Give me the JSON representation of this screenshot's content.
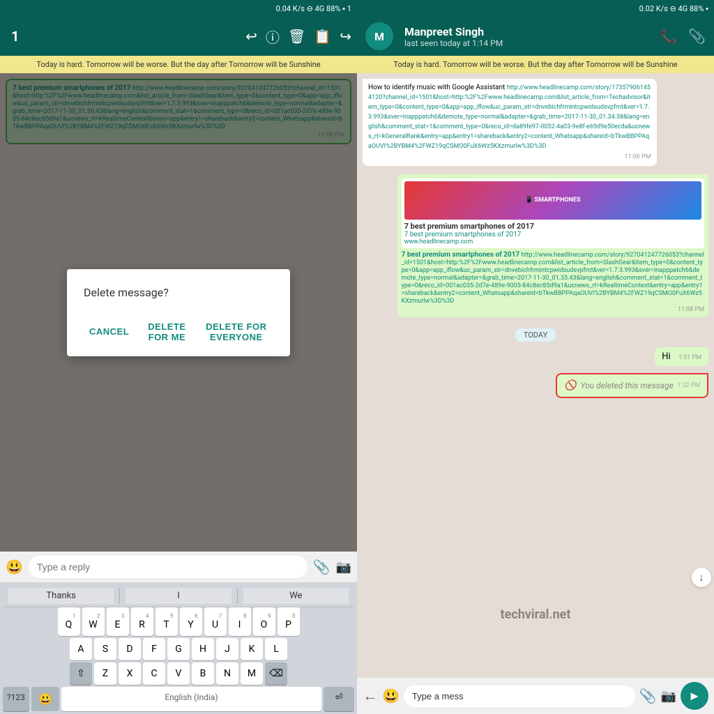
{
  "left": {
    "status_bar": "0.04 K/s ⊖ 4G 88% ▪ 1",
    "toolbar": {
      "count": "1",
      "icons": [
        "reply-icon",
        "info-icon",
        "delete-icon",
        "copy-icon",
        "forward-icon"
      ]
    },
    "notification": "Today is hard. Tomorrow will be worse. But the day after Tomorrow will be Sunshine",
    "message_title": "7 best premium smartphones of 2017",
    "message_url": "http://www.headlinecamp.com/story/927041247726053?channel_id=1501&host=http:%2F%2Fwww.headlinecamp.com&list_article_from=SlashGear&item_type=0&content_type=0&app=app_iflow&uc_param_str=dnvebichfrmintcpwidsudsvpfmt&ver=1.7.3.993&sver=inapppatch6&demote_type=normal&adapter=&grab_time=2017-11-30_01.35.43&lang=english&comment_stat=1&comment_type=0&reco_id=001ac035-2d7e-489e-9005-84c8ec85d9a1&ucnews_rt=kRealtimeContext&entry=app&entry1=shareback&entry2=content_Whatsapp&shareid=bTkwBBPPAqaOUVI%2BYBM4%2FWZ19qCSMO0FuX6Wz5KXzmurlw%3D%3D",
    "message_time": "11:08 PM",
    "dialog": {
      "title": "Delete message?",
      "cancel": "CANCEL",
      "delete_for_me": "DELETE FOR ME",
      "delete_for_everyone": "DELETE FOR EVERYONE"
    },
    "input_placeholder": "Type a reply",
    "keyboard": {
      "row1": [
        "Q",
        "W",
        "E",
        "R",
        "T",
        "Y",
        "U",
        "I",
        "O",
        "P"
      ],
      "row2": [
        "A",
        "S",
        "D",
        "F",
        "G",
        "H",
        "J",
        "K",
        "L"
      ],
      "row3": [
        "Z",
        "X",
        "C",
        "V",
        "B",
        "N",
        "M"
      ],
      "thanks_suggestion": "Thanks",
      "i_suggestion": "I",
      "we_suggestion": "We"
    }
  },
  "right": {
    "status_bar": "0.02 K/s ⊖ 4G 88% ▪",
    "contact": {
      "name": "Manpreet Singh",
      "status": "last seen today at 1:14 PM"
    },
    "notification": "Today is hard. Tomorrow will be worse. But the day after Tomorrow will be Sunshine",
    "messages": [
      {
        "type": "received",
        "text": "How to identify music with Google Assistant",
        "link": "http://www.headlinecamp.com/story/173579061454120?channel_id=1501&host=http:%2F%2Fwww.headlinecamp.com&list_article_from=Techadvisor&item_type=0&content_type=0&app=app_iflow&uc_param_str=dnvebichfrmintcpwidsudsvpfmt&ver=1.7.3.993&sver=inapppatch6&demote_type=normal&adapter=&grab_time=2017-11-30_01.34.38&lang=english&comment_stat=1&comment_type=0&reco_id=da89fe97-0052-4a03-9e8f-e69d9e50ecda&ucnews_rt=kGeneralRank&entry=app&entry1=shareback&entry2=content_Whatsapp&shareid=bTkwBBPPAqaOUVI%2BYBM4%2FWZ19qCSMO0FuX6Wz5KXzmurlw%3D%3D",
        "time": "11:06 PM"
      },
      {
        "type": "sent_preview",
        "preview_title": "7 best premium smartphones of 2017",
        "preview_url": "www.headlinecamp.com",
        "text": "7 best premium smartphones of 2017",
        "link": "http://www.headlinecamp.com/story/927041247726053?channel_id=1501&host=http:%2F%2Fwww.headlinecamp.com&list_article_from=SlashGear&item_type=0&content_type=0&app=app_iflow&uc_param_str=dnvebichfrmintcpwidsudsvpfmt&ver=1.7.3.993&sver=inapppatch6&demote_type=normal&adapter=&grab_time=2017-11-30_01.35.43&lang=english&comment_stat=1&comment_type=0&reco_id=001ac035-2d7e-489e-9005-84c8ec85d9a1&ucnews_rt=kRealtimeContext&entry=app&entry1=shareback&entry2=content_Whatsapp&shareid=bTkwBBPPAqaOUVI%2BYBM4%2FWZ19qCSMO0FuX6Wz5KXzmurlw%3D%3D",
        "time": "11:08 PM"
      }
    ],
    "today_label": "TODAY",
    "hi_message": {
      "text": "Hi",
      "time": "1:31 PM"
    },
    "deleted_message": {
      "text": "You deleted this message",
      "time": "1:32 PM",
      "icon": "🚫"
    },
    "input_placeholder": "Type a mess",
    "watermark": "techviral.net"
  }
}
